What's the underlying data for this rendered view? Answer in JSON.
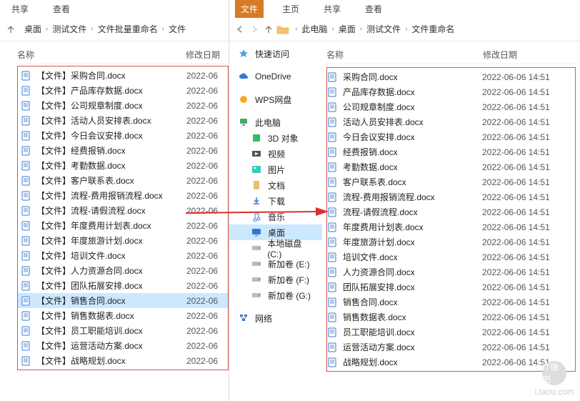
{
  "left": {
    "ribbon": [
      "共享",
      "查看"
    ],
    "breadcrumb": [
      "桌面",
      "测试文件",
      "文件批量重命名",
      "文件"
    ],
    "columns": {
      "name": "名称",
      "date": "修改日期"
    },
    "files": [
      {
        "name": "【文件】采购合同.docx",
        "date": "2022-06"
      },
      {
        "name": "【文件】产品库存数据.docx",
        "date": "2022-06"
      },
      {
        "name": "【文件】公司规章制度.docx",
        "date": "2022-06"
      },
      {
        "name": "【文件】活动人员安排表.docx",
        "date": "2022-06"
      },
      {
        "name": "【文件】今日会议安排.docx",
        "date": "2022-06"
      },
      {
        "name": "【文件】经费报销.docx",
        "date": "2022-06"
      },
      {
        "name": "【文件】考勤数据.docx",
        "date": "2022-06"
      },
      {
        "name": "【文件】客户联系表.docx",
        "date": "2022-06"
      },
      {
        "name": "【文件】流程-费用报销流程.docx",
        "date": "2022-06"
      },
      {
        "name": "【文件】流程-请假流程.docx",
        "date": "2022-06"
      },
      {
        "name": "【文件】年度费用计划表.docx",
        "date": "2022-06"
      },
      {
        "name": "【文件】年度旅游计划.docx",
        "date": "2022-06"
      },
      {
        "name": "【文件】培训文件.docx",
        "date": "2022-06"
      },
      {
        "name": "【文件】人力资源合同.docx",
        "date": "2022-06"
      },
      {
        "name": "【文件】团队拓展安排.docx",
        "date": "2022-06"
      },
      {
        "name": "【文件】销售合同.docx",
        "date": "2022-06",
        "selected": true
      },
      {
        "name": "【文件】销售数据表.docx",
        "date": "2022-06"
      },
      {
        "name": "【文件】员工职能培训.docx",
        "date": "2022-06"
      },
      {
        "name": "【文件】运营活动方案.docx",
        "date": "2022-06"
      },
      {
        "name": "【文件】战略规划.docx",
        "date": "2022-06"
      }
    ]
  },
  "right": {
    "ribbon": [
      "文件",
      "主页",
      "共享",
      "查看"
    ],
    "ribbon_active": 0,
    "breadcrumb": [
      "此电脑",
      "桌面",
      "测试文件",
      "文件重命名"
    ],
    "columns": {
      "name": "名称",
      "date": "修改日期"
    },
    "nav": {
      "quick": "快速访问",
      "onedrive": "OneDrive",
      "wps": "WPS网盘",
      "thispc": "此电脑",
      "thispc_children": [
        {
          "icon": "3d",
          "label": "3D 对象"
        },
        {
          "icon": "video",
          "label": "视频"
        },
        {
          "icon": "pictures",
          "label": "图片"
        },
        {
          "icon": "docs",
          "label": "文档"
        },
        {
          "icon": "downloads",
          "label": "下载"
        },
        {
          "icon": "music",
          "label": "音乐"
        },
        {
          "icon": "desktop",
          "label": "桌面",
          "selected": true
        },
        {
          "icon": "drive",
          "label": "本地磁盘 (C:)"
        },
        {
          "icon": "drive",
          "label": "新加卷 (E:)"
        },
        {
          "icon": "drive",
          "label": "新加卷 (F:)"
        },
        {
          "icon": "drive",
          "label": "新加卷 (G:)"
        }
      ],
      "network": "网络"
    },
    "files": [
      {
        "name": "采购合同.docx",
        "date": "2022-06-06 14:51"
      },
      {
        "name": "产品库存数据.docx",
        "date": "2022-06-06 14:51"
      },
      {
        "name": "公司规章制度.docx",
        "date": "2022-06-06 14:51"
      },
      {
        "name": "活动人员安排表.docx",
        "date": "2022-06-06 14:51"
      },
      {
        "name": "今日会议安排.docx",
        "date": "2022-06-06 14:51"
      },
      {
        "name": "经费报销.docx",
        "date": "2022-06-06 14:51"
      },
      {
        "name": "考勤数据.docx",
        "date": "2022-06-06 14:51"
      },
      {
        "name": "客户联系表.docx",
        "date": "2022-06-06 14:51"
      },
      {
        "name": "流程-费用报销流程.docx",
        "date": "2022-06-06 14:51"
      },
      {
        "name": "流程-请假流程.docx",
        "date": "2022-06-06 14:51"
      },
      {
        "name": "年度费用计划表.docx",
        "date": "2022-06-06 14:51"
      },
      {
        "name": "年度旅游计划.docx",
        "date": "2022-06-06 14:51"
      },
      {
        "name": "培训文件.docx",
        "date": "2022-06-06 14:51"
      },
      {
        "name": "人力资源合同.docx",
        "date": "2022-06-06 14:51"
      },
      {
        "name": "团队拓展安排.docx",
        "date": "2022-06-06 14:51"
      },
      {
        "name": "销售合同.docx",
        "date": "2022-06-06 14:51"
      },
      {
        "name": "销售数据表.docx",
        "date": "2022-06-06 14:51"
      },
      {
        "name": "员工职能培训.docx",
        "date": "2022-06-06 14:51"
      },
      {
        "name": "运营活动方案.docx",
        "date": "2022-06-06 14:51"
      },
      {
        "name": "战略规划.docx",
        "date": "2022-06-06 14:51"
      }
    ]
  },
  "watermark": {
    "label": "IT微吧",
    "url": "i.taou.com"
  }
}
